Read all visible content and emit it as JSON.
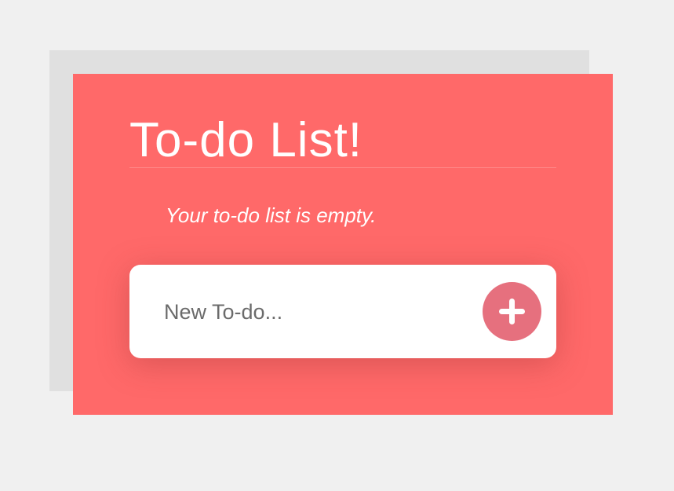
{
  "app": {
    "title": "To-do List!",
    "empty_message": "Your to-do list is empty."
  },
  "new_todo": {
    "placeholder": "New To-do...",
    "value": "",
    "add_icon": "plus-icon"
  },
  "colors": {
    "page_background": "#f0f0f0",
    "back_panel": "#e0e0e0",
    "card": "#ff6969",
    "add_button": "#e6707e",
    "input_card": "#ffffff"
  },
  "todos": []
}
